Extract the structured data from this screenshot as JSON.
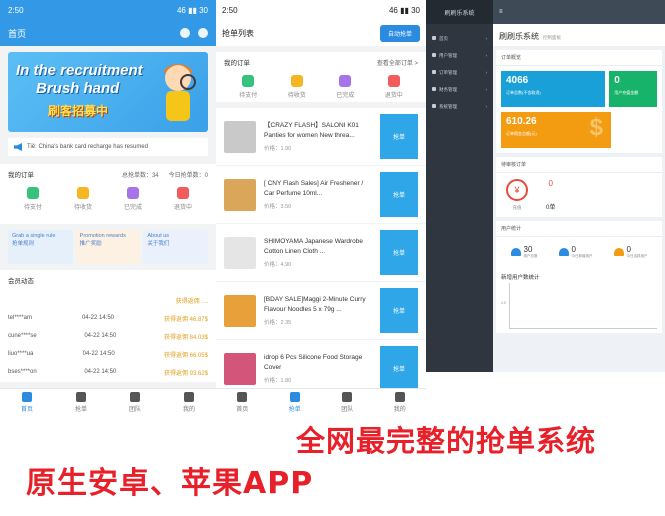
{
  "phone1": {
    "status_time": "2:50",
    "status_right": "46 ▮▮ 30",
    "header_title": "首页",
    "banner": {
      "line1": "In the recruitment",
      "line2": "Brush hand",
      "line3": "刷客招募中"
    },
    "notice": "Tiě: China's bank card recharge has resumed",
    "orders": {
      "title": "我的订单",
      "total_label": "总抢单数：34",
      "today_label": "今日抢单数：0",
      "items": [
        {
          "label": "待支付",
          "color": "#36c27a"
        },
        {
          "label": "待收货",
          "color": "#f5b622"
        },
        {
          "label": "已完成",
          "color": "#a674e8"
        },
        {
          "label": "退货中",
          "color": "#f25b5b"
        }
      ]
    },
    "tiles": [
      {
        "en": "Grab a single rule",
        "zh": "抢单规则",
        "bg": "#e6f0fb"
      },
      {
        "en": "Promotion rewards",
        "zh": "推广奖励",
        "bg": "#fdf1e4"
      },
      {
        "en": "About us",
        "zh": "关于我们",
        "bg": "#eaf0fc"
      }
    ],
    "dynamics": {
      "title": "会员动态",
      "rows": [
        {
          "user": "",
          "time": "",
          "amount": "获得返佣 ...."
        },
        {
          "user": "tel****am",
          "time": "04-22 14:50",
          "amount": "获得返佣 46.87$"
        },
        {
          "user": "cune****se",
          "time": "04-22 14:50",
          "amount": "获得返佣 84.03$"
        },
        {
          "user": "liuo****ua",
          "time": "04-22 14:50",
          "amount": "获得返佣 66.05$"
        },
        {
          "user": "bses****on",
          "time": "04-22 14:50",
          "amount": "获得返佣 93.62$"
        }
      ]
    },
    "tabs": [
      "首页",
      "抢单",
      "团队",
      "我的"
    ]
  },
  "phone2": {
    "status_time": "2:50",
    "status_right": "46 ▮▮ 30",
    "header_title": "抢单列表",
    "header_button": "自动抢单",
    "orders_title": "我的订单",
    "orders_link": "查看全部订单 >",
    "order_items": [
      {
        "label": "待支付",
        "color": "#36c27a"
      },
      {
        "label": "待收货",
        "color": "#f5b622"
      },
      {
        "label": "已完成",
        "color": "#a674e8"
      },
      {
        "label": "退货中",
        "color": "#f25b5b"
      }
    ],
    "grab_label": "抢单",
    "products": [
      {
        "name": "【CRAZY FLASH】SALONI K01 Panties for women New threa...",
        "price": "价格：1.90",
        "thumb": "#c9c9c9"
      },
      {
        "name": "[ CNY Flash Sales] Air Freshener / Car Perfume 10ml...",
        "price": "价格：3.50",
        "thumb": "#d9a65a"
      },
      {
        "name": "SHIMOYAMA Japanese Wardrobe Cotton Linen Cloth ...",
        "price": "价格：4.90",
        "thumb": "#e5e5e5"
      },
      {
        "name": "[BDAY SALE]Maggi 2-Minute Curry Flavour Noodles 5 x 79g ...",
        "price": "价格：2.35",
        "thumb": "#e8a13a"
      },
      {
        "name": "idrop 6 Pcs Silicone Food Storage Cover",
        "price": "价格：1.80",
        "thumb": "#d4557a"
      }
    ],
    "tabs": [
      "首页",
      "抢单",
      "团队",
      "我的"
    ]
  },
  "admin": {
    "logo": "刷刷乐系统",
    "topbar_icon": "≡",
    "title": "刷刷乐系统",
    "subtitle": "控制面板",
    "menu": [
      "首页",
      "用户管理",
      "订单管理",
      "财务管理",
      "系统管理"
    ],
    "overview_title": "订单概览",
    "cards": [
      {
        "value": "4066",
        "label": "订单总数(不含取消)",
        "bg": "#1aa0d8"
      },
      {
        "value": "0",
        "label": "用户充值金额",
        "bg": "#18b36a"
      },
      {
        "value": "610.26",
        "label": "订单佣金总额(元)",
        "bg": "#f39c12"
      }
    ],
    "pending_title": "待审核订单",
    "pending_label": "充值",
    "pending_value": "0",
    "pending_withdraw_value": "0单",
    "user_title": "用户统计",
    "user_stats": [
      {
        "value": "30",
        "label": "用户总数",
        "color": "#2b8be0"
      },
      {
        "value": "0",
        "label": "今日新增用户",
        "color": "#2b8be0"
      },
      {
        "value": "0",
        "label": "今日活跃用户",
        "color": "#f39c12"
      }
    ],
    "chart_title": "新增用户数统计",
    "chart_tick": "0.5"
  },
  "slogans": {
    "line1": "全网最完整的抢单系统",
    "line2": "原生安卓、苹果APP"
  }
}
